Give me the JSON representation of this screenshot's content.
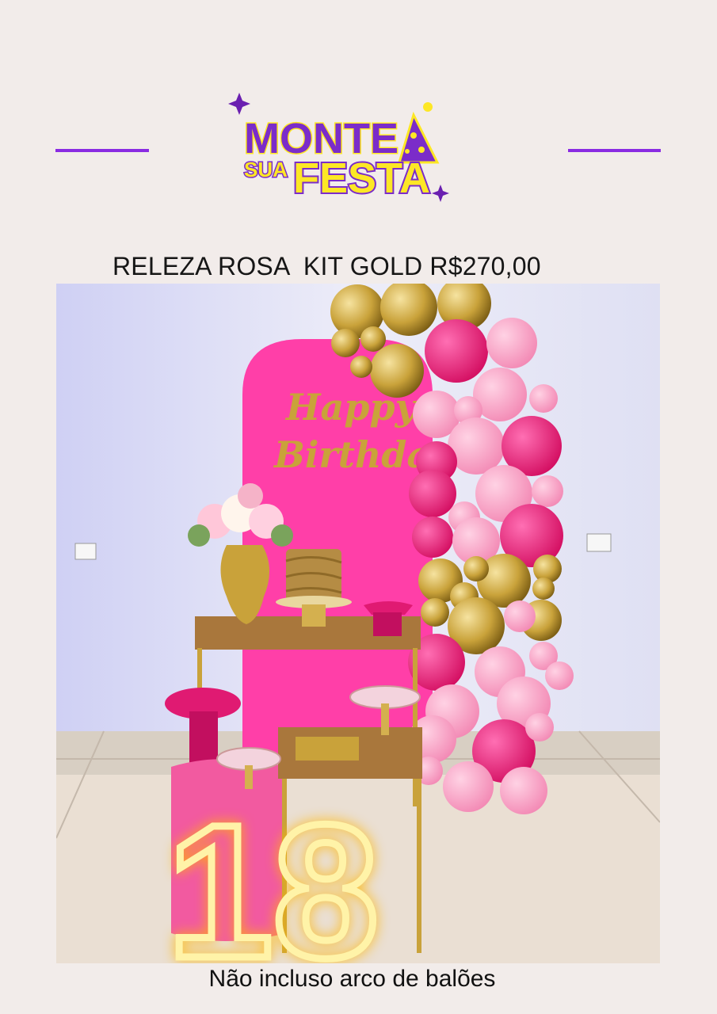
{
  "logo": {
    "line1": "MONTE",
    "word_small": "SUA",
    "word_big": "FESTA"
  },
  "title": "RELEZA ROSA  KIT GOLD R$270,00",
  "photo": {
    "sign_line1": "Happy",
    "sign_line2": "Birthday",
    "neon_number": "18"
  },
  "footer": "Não incluso arco de balões",
  "colors": {
    "accent": "#8a2be2",
    "logo_purple": "#7b2cc9",
    "logo_yellow": "#fde725",
    "background": "#f2ecea",
    "pink": "#ff3fa8",
    "gold": "#c9a23a"
  }
}
